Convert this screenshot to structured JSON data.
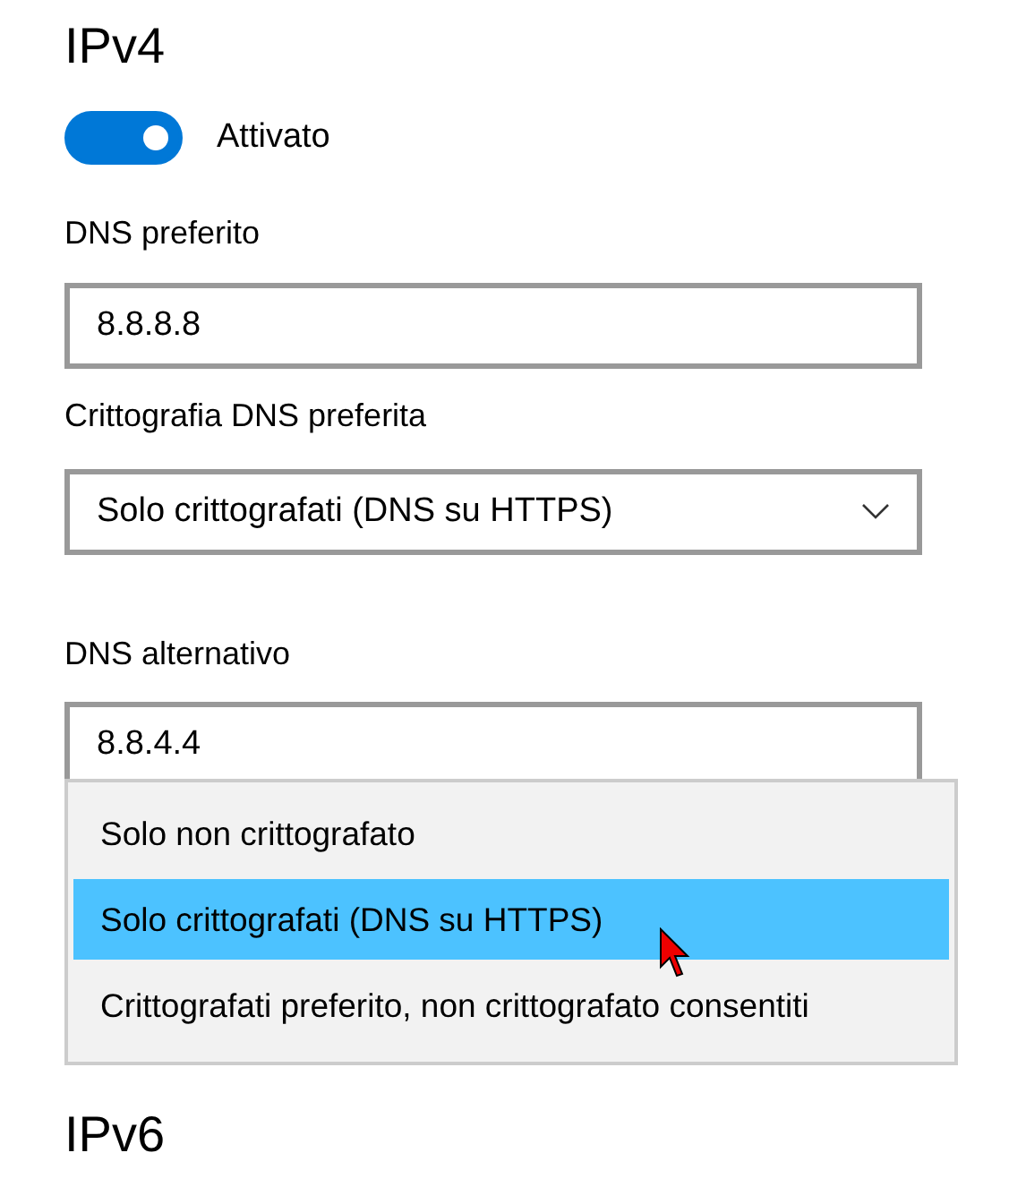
{
  "ipv4": {
    "title": "IPv4",
    "toggle": {
      "on": true,
      "label": "Attivato"
    },
    "preferred_dns": {
      "label": "DNS preferito",
      "value": "8.8.8.8"
    },
    "preferred_encryption": {
      "label": "Crittografia DNS preferita",
      "value": "Solo crittografati (DNS su HTTPS)"
    },
    "alternate_dns": {
      "label": "DNS alternativo",
      "value": "8.8.4.4"
    },
    "alternate_encryption_menu": {
      "options": [
        {
          "label": "Solo non crittografato",
          "selected": false
        },
        {
          "label": "Solo crittografati (DNS su HTTPS)",
          "selected": true
        },
        {
          "label": "Crittografati preferito, non crittografato consentiti",
          "selected": false
        }
      ]
    }
  },
  "ipv6": {
    "title": "IPv6"
  }
}
